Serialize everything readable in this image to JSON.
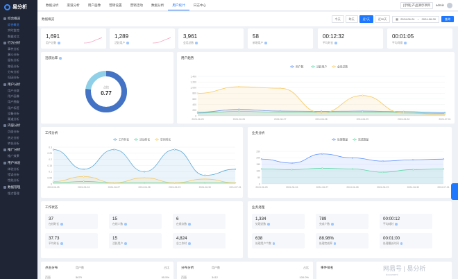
{
  "app": {
    "name": "易分析"
  },
  "sidebar": {
    "groups": [
      {
        "label": "综合概览",
        "items": [
          "综合概览",
          "实时监控",
          "数据对比"
        ]
      },
      {
        "label": "行为分析",
        "items": [
          "事件分析",
          "漏斗分析",
          "留存分析",
          "路径分析",
          "分布分析",
          "归因分析"
        ]
      },
      {
        "label": "用户分析",
        "items": [
          "用户分群",
          "用户画像",
          "用户细查",
          "用户标签",
          "设备分析",
          "渠道分析"
        ]
      },
      {
        "label": "内容分析",
        "items": [
          "页面分析",
          "热力分析",
          "转化分析"
        ]
      },
      {
        "label": "推广分析",
        "items": [
          "推广效果"
        ]
      },
      {
        "label": "用户体验",
        "items": [
          "体验分析",
          "错误分析",
          "性能分析"
        ]
      },
      {
        "label": "数据管理",
        "items": [
          "埋点管理"
        ]
      }
    ]
  },
  "topnav": {
    "tabs": [
      "数据分析",
      "渠道分析",
      "用户画像",
      "营销设置",
      "营销活动",
      "数据分析",
      "用户统计",
      "日志中心"
    ],
    "active_index": 6,
    "project": "[示例] 产品演示项目",
    "user": "admin"
  },
  "subbar": {
    "title": "数据概览",
    "ranges": [
      "今天",
      "昨天",
      "近7天",
      "近30天"
    ],
    "active_range": 2,
    "date_start": "2024-06-24",
    "date_end": "2024-06-30",
    "query_label": "查询"
  },
  "kpis": [
    {
      "value": "1,691",
      "label": "用户总数"
    },
    {
      "value": "1,289",
      "label": "活跃用户"
    },
    {
      "value": "3,961",
      "label": "会话总数"
    },
    {
      "value": "58",
      "label": "新增用户"
    },
    {
      "value": "00:12:32",
      "label": "平均时长"
    },
    {
      "value": "00:01:05",
      "label": "平均间隔"
    }
  ],
  "donut": {
    "title": "活跃比率",
    "center_label": "占比",
    "value": "0.77",
    "fraction": 0.77
  },
  "user_trend": {
    "title": "用户趋势",
    "chart_data": {
      "type": "area",
      "categories": [
        "2024-06-25",
        "2024-06-26",
        "2024-06-27",
        "2024-06-28",
        "2024-06-29",
        "2024-06-30",
        "2024-07-01"
      ],
      "ylim": [
        0,
        1400
      ],
      "yticks": [
        "0",
        "200",
        "400",
        "600",
        "800",
        "1,000",
        "1,200",
        "1,400"
      ],
      "series": [
        {
          "name": "用户数",
          "color": "#5b8ff9",
          "values": [
            130,
            230,
            170,
            160,
            170,
            150,
            120
          ]
        },
        {
          "name": "活跃用户",
          "color": "#5ad8a6",
          "values": [
            100,
            160,
            130,
            120,
            130,
            110,
            90
          ]
        },
        {
          "name": "会话总数",
          "color": "#f6c85f",
          "values": [
            800,
            1030,
            980,
            110,
            720,
            100,
            50
          ]
        }
      ]
    }
  },
  "work_trend": {
    "title": "工作分析",
    "chart_data": {
      "type": "area",
      "categories": [
        "2024-06-25",
        "2024-06-26",
        "2024-06-27",
        "2024-06-28",
        "2024-06-29",
        "2024-06-30",
        "2024-07-01"
      ],
      "ylim": [
        0,
        0.3
      ],
      "yticks": [
        "0",
        "0.05",
        "0.1",
        "0.15",
        "0.2",
        "0.25",
        "0.3"
      ],
      "series": [
        {
          "name": "工作时长",
          "color": "#5aa7d6",
          "values": [
            0.28,
            0.12,
            0.28,
            0.1,
            0.28,
            0.07,
            0.12
          ]
        },
        {
          "name": "活动时长",
          "color": "#5ad8a6",
          "values": [
            0.01,
            0.02,
            0.01,
            0.01,
            0.01,
            0.01,
            0.01
          ]
        },
        {
          "name": "空闲时长",
          "color": "#f6c85f",
          "values": [
            0.02,
            0.06,
            0.01,
            0.05,
            0.01,
            0.04,
            0.01
          ]
        }
      ]
    }
  },
  "biz_trend": {
    "title": "业务分析",
    "chart_data": {
      "type": "area",
      "categories": [
        "2024-06-25",
        "2024-06-26",
        "2024-06-27",
        "2024-06-28",
        "2024-06-29",
        "2024-06-30",
        "2024-07-01"
      ],
      "ylim": [
        0,
        250
      ],
      "yticks": [
        "0",
        "50",
        "100",
        "150",
        "200",
        "250"
      ],
      "series": [
        {
          "name": "处理数量",
          "color": "#5b8ff9",
          "values": [
            190,
            160,
            230,
            200,
            175,
            185,
            190
          ]
        },
        {
          "name": "完成数量",
          "color": "#5ad8a6",
          "values": [
            115,
            110,
            120,
            115,
            90,
            110,
            115
          ]
        }
      ]
    }
  },
  "work_stats": {
    "title": "工作状态",
    "items": [
      {
        "value": "37",
        "label": "在线时长"
      },
      {
        "value": "15",
        "label": "在线人数"
      },
      {
        "value": "6",
        "label": "在线次数"
      },
      {
        "value": "37.73",
        "label": "平均时长"
      },
      {
        "value": "15",
        "label": "活跃用户"
      },
      {
        "value": "4,824",
        "label": "总工作时"
      }
    ]
  },
  "biz_stats": {
    "title": "业务处理",
    "items": [
      {
        "value": "1,334",
        "label": "处理总数"
      },
      {
        "value": "789",
        "label": "完成个数"
      },
      {
        "value": "00:00:12",
        "label": "平均耗时"
      },
      {
        "value": "638",
        "label": "处理用户个数"
      },
      {
        "value": "88.98%",
        "label": "处理完成率"
      },
      {
        "value": "00:01:00",
        "label": "处理最长时间"
      }
    ]
  },
  "bottom_cards": [
    {
      "title": "点击分布",
      "col1": "用户数",
      "col2": "占比",
      "row": [
        "页面",
        "5679",
        "95.5%"
      ]
    },
    {
      "title": "分布分析",
      "col1": "用户数",
      "col2": "占比",
      "row": [
        "页面",
        "3412",
        "100.0%"
      ]
    },
    {
      "title": "事件排名",
      "col1": "",
      "col2": "",
      "row": [
        "",
        "",
        ""
      ]
    }
  ],
  "watermark": {
    "main": "网易号 | 易分析",
    "sub": "document"
  }
}
